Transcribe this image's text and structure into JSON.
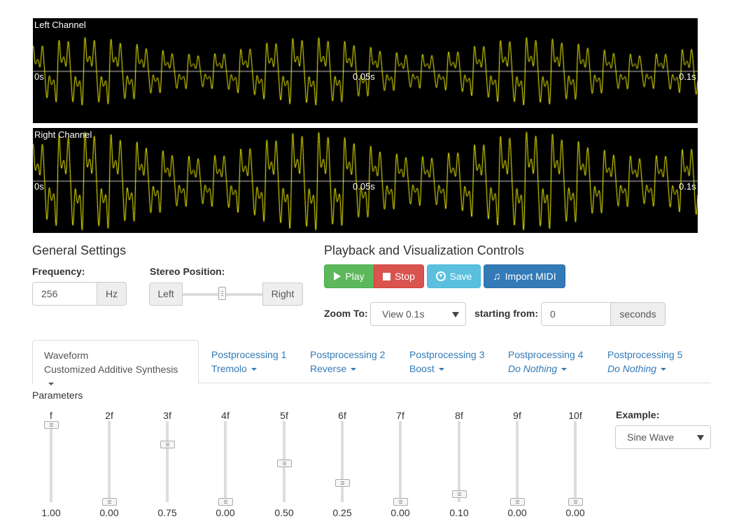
{
  "scopes": {
    "left": {
      "label": "Left Channel",
      "ticks": [
        "0s",
        "0.05s",
        "0.1s"
      ]
    },
    "right": {
      "label": "Right Channel",
      "ticks": [
        "0s",
        "0.05s",
        "0.1s"
      ]
    },
    "background_color": "#000000",
    "wave_color": "#ffff00",
    "axis_color": "#c8c8c8"
  },
  "general": {
    "title": "General Settings",
    "frequency_label": "Frequency:",
    "frequency_value": "256",
    "frequency_unit": "Hz",
    "stereo_label": "Stereo Position:",
    "stereo_left": "Left",
    "stereo_right": "Right",
    "stereo_position": 0.5
  },
  "playback": {
    "title": "Playback and Visualization Controls",
    "play": "Play",
    "stop": "Stop",
    "save": "Save",
    "import_midi": "Import MIDI",
    "zoom_label": "Zoom To:",
    "zoom_value": "View 0.1s",
    "starting_label": "starting from:",
    "starting_value": "0",
    "starting_unit": "seconds",
    "colors": {
      "play": "#5cb85c",
      "stop": "#d9534f",
      "save": "#5bc0de",
      "midi": "#337ab7"
    }
  },
  "tabs": [
    {
      "title": "Waveform",
      "value": "Customized Additive Synthesis",
      "italic": false,
      "active": true
    },
    {
      "title": "Postprocessing 1",
      "value": "Tremolo",
      "italic": false,
      "active": false
    },
    {
      "title": "Postprocessing 2",
      "value": "Reverse",
      "italic": false,
      "active": false
    },
    {
      "title": "Postprocessing 3",
      "value": "Boost",
      "italic": false,
      "active": false
    },
    {
      "title": "Postprocessing 4",
      "value": "Do Nothing",
      "italic": true,
      "active": false
    },
    {
      "title": "Postprocessing 5",
      "value": "Do Nothing",
      "italic": true,
      "active": false
    }
  ],
  "parameters": {
    "title": "Parameters",
    "sliders": [
      {
        "label": "f",
        "value": "1.00",
        "level": 1.0
      },
      {
        "label": "2f",
        "value": "0.00",
        "level": 0.0
      },
      {
        "label": "3f",
        "value": "0.75",
        "level": 0.75
      },
      {
        "label": "4f",
        "value": "0.00",
        "level": 0.0
      },
      {
        "label": "5f",
        "value": "0.50",
        "level": 0.5
      },
      {
        "label": "6f",
        "value": "0.25",
        "level": 0.25
      },
      {
        "label": "7f",
        "value": "0.00",
        "level": 0.0
      },
      {
        "label": "8f",
        "value": "0.10",
        "level": 0.1
      },
      {
        "label": "9f",
        "value": "0.00",
        "level": 0.0
      },
      {
        "label": "10f",
        "value": "0.00",
        "level": 0.0
      }
    ],
    "example_label": "Example:",
    "example_value": "Sine Wave"
  }
}
